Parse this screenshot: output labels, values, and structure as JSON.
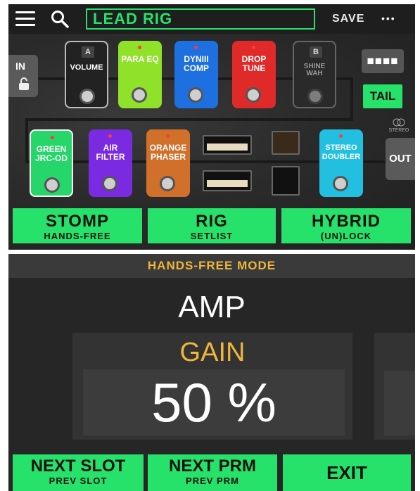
{
  "top": {
    "preset_name": "LEAD RIG",
    "save_label": "SAVE",
    "more_label": "•••"
  },
  "signal_chain": {
    "input_label": "IN",
    "output_label": "OUT",
    "tail_label": "TAIL",
    "stereo_label": "STEREO",
    "dots_label": "■■■■",
    "row1": [
      {
        "letter": "A",
        "label": "VOLUME",
        "color": "#222222"
      },
      {
        "label": "PARA EQ",
        "color": "#8fe12a"
      },
      {
        "label": "DYNIII\nCOMP",
        "color": "#1e6fe0"
      },
      {
        "label": "DROP\nTUNE",
        "color": "#e02a2a"
      },
      {
        "letter": "B",
        "label": "SHINE\nWAH",
        "color": "#2a2a2a"
      }
    ],
    "row2": [
      {
        "label": "GREEN\nJRC-OD",
        "color": "#26d66a"
      },
      {
        "label": "AIR\nFILTER",
        "color": "#7a2ae0"
      },
      {
        "label": "ORANGE\nPHASER",
        "color": "#d0702a"
      },
      {
        "label": "STEREO\nDOUBLER",
        "color": "#22bfe0"
      }
    ]
  },
  "top_buttons": [
    {
      "main": "STOMP",
      "sub": "HANDS-FREE"
    },
    {
      "main": "RIG",
      "sub": "SETLIST"
    },
    {
      "main": "HYBRID",
      "sub": "(UN)LOCK"
    }
  ],
  "hands_free": {
    "header": "HANDS-FREE MODE",
    "block": "AMP",
    "param": "GAIN",
    "value": "50 %"
  },
  "bottom_buttons": [
    {
      "main": "NEXT SLOT",
      "sub": "PREV SLOT"
    },
    {
      "main": "NEXT PRM",
      "sub": "PREV PRM"
    },
    {
      "main": "EXIT",
      "sub": ""
    }
  ],
  "colors": {
    "accent_green": "#26e26a",
    "accent_yellow": "#f0b63c"
  }
}
